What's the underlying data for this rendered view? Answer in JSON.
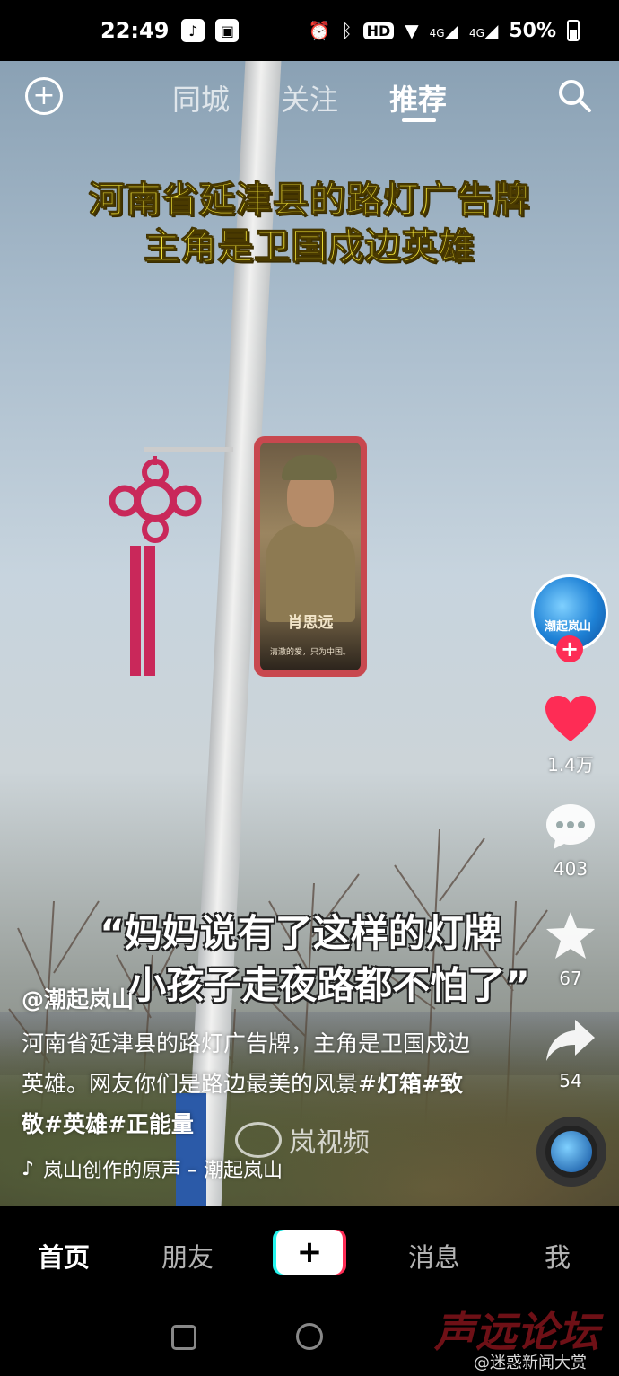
{
  "status_bar": {
    "time": "22:49",
    "hd_label": "HD",
    "network_1": "4G",
    "network_2": "4G",
    "battery": "50%"
  },
  "top_nav": {
    "tabs": [
      {
        "label": "同城",
        "active": false
      },
      {
        "label": "关注",
        "active": false
      },
      {
        "label": "推荐",
        "active": true
      }
    ]
  },
  "video": {
    "caption_line1": "河南省延津县的路灯广告牌",
    "caption_line2": "主角是卫国戍边英雄",
    "billboard_name": "肖思远",
    "billboard_slogan": "清澈的爱，只为中国。",
    "quote_line1": "“妈妈说有了这样的灯牌",
    "quote_line2": "小孩子走夜路都不怕了”",
    "watermark": "岚视频"
  },
  "author": {
    "handle": "@潮起岚山",
    "avatar_text": "潮起岚山"
  },
  "description": {
    "text": "河南省延津县的路灯广告牌，主角是卫国戍边英雄。网友你们是路边最美的风景#",
    "hashtags": "灯箱#致敬#英雄#正能量"
  },
  "music": {
    "label": "岚山创作的原声 – 潮起岚山"
  },
  "actions": {
    "likes": "1.4万",
    "comments": "403",
    "favorites": "67",
    "shares": "54"
  },
  "bottom_tabs": [
    {
      "label": "首页",
      "active": true
    },
    {
      "label": "朋友",
      "active": false
    },
    {
      "label": "消息",
      "active": false
    },
    {
      "label": "我",
      "active": false
    }
  ],
  "overlay_marks": {
    "forum": "声远论坛",
    "weibo": "@迷惑新闻大赏"
  },
  "colors": {
    "like_red": "#fe2c55",
    "caption_yellow": "#f5e83a",
    "accent_cyan": "#25f4ee"
  }
}
